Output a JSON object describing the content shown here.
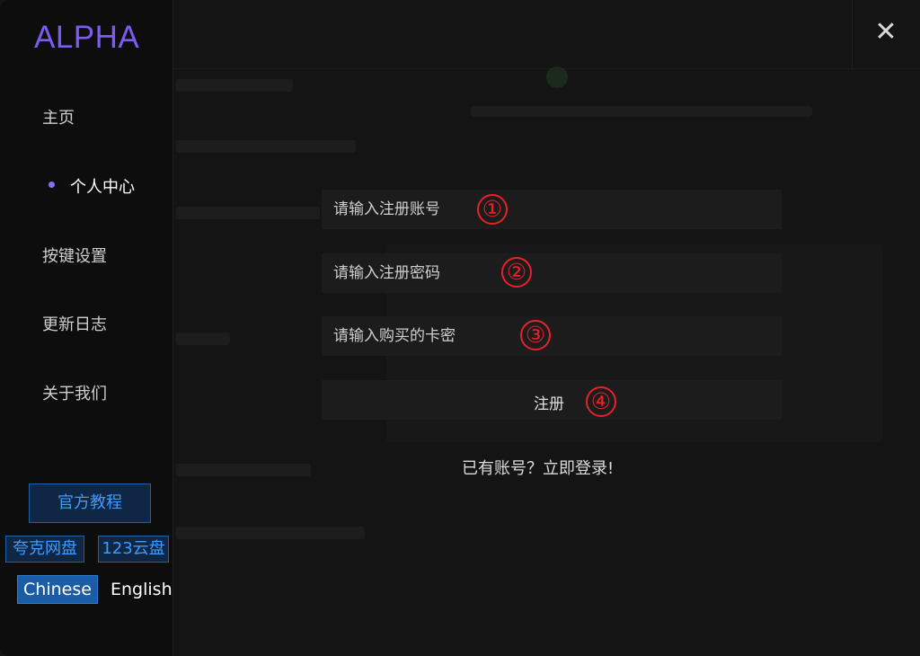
{
  "app": {
    "logo": "ALPHA"
  },
  "sidebar": {
    "nav": [
      {
        "label": "主页",
        "active": false
      },
      {
        "label": "个人中心",
        "active": true
      },
      {
        "label": "按键设置",
        "active": false
      },
      {
        "label": "更新日志",
        "active": false
      },
      {
        "label": "关于我们",
        "active": false
      }
    ],
    "tutorial_label": "官方教程",
    "quark_label": "夸克网盘",
    "cloud123_label": "123云盘",
    "lang_chinese": "Chinese",
    "lang_english": "English"
  },
  "window": {
    "close_icon": "close-icon",
    "close_glyph": "✕"
  },
  "register": {
    "account_placeholder": "请输入注册账号",
    "password_placeholder": "请输入注册密码",
    "card_placeholder": "请输入购买的卡密",
    "submit_label": "注册",
    "login_link": "已有账号？立即登录!",
    "badges": [
      "①",
      "②",
      "③",
      "④"
    ],
    "badge_color": "#e8202a"
  },
  "colors": {
    "accent": "#7a5cf0",
    "link_blue": "#3b9bff",
    "lang_active": "#1a5da6"
  }
}
